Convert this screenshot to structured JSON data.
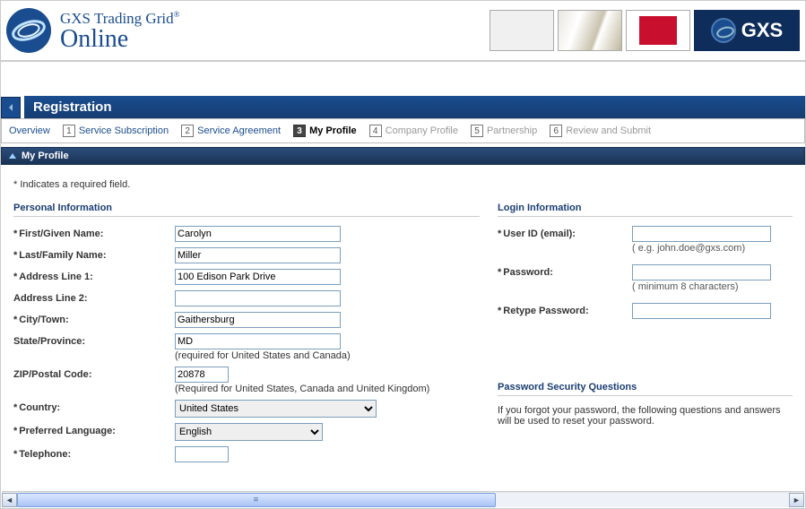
{
  "brand": {
    "line1": "GXS Trading Grid",
    "reg": "®",
    "line2": "Online",
    "badge": "GXS"
  },
  "section_title": "Registration",
  "steps": {
    "overview": "Overview",
    "s1_num": "1",
    "s1": "Service Subscription",
    "s2_num": "2",
    "s2": "Service Agreement",
    "s3_num": "3",
    "s3": "My Profile",
    "s4_num": "4",
    "s4": "Company Profile",
    "s5_num": "5",
    "s5": "Partnership",
    "s6_num": "6",
    "s6": "Review and Submit"
  },
  "panel_title": "My Profile",
  "required_note": "* Indicates a required field.",
  "personal": {
    "header": "Personal Information",
    "first_label": "First/Given Name:",
    "first_value": "Carolyn",
    "last_label": "Last/Family Name:",
    "last_value": "Miller",
    "addr1_label": "Address Line 1:",
    "addr1_value": "100 Edison Park Drive",
    "addr2_label": "Address Line 2:",
    "addr2_value": "",
    "city_label": "City/Town:",
    "city_value": "Gaithersburg",
    "state_label": "State/Province:",
    "state_value": "MD",
    "state_hint": "(required for United States and Canada)",
    "zip_label": "ZIP/Postal Code:",
    "zip_value": "20878",
    "zip_hint": "(Required for United States, Canada and United Kingdom)",
    "country_label": "Country:",
    "country_value": "United States",
    "lang_label": "Preferred Language:",
    "lang_value": "English",
    "phone_label": "Telephone:",
    "phone_value": ""
  },
  "login": {
    "header": "Login Information",
    "user_label": "User ID (email):",
    "user_value": "",
    "user_hint": "( e.g. john.doe@gxs.com)",
    "pw_label": "Password:",
    "pw_value": "",
    "pw_hint": "( minimum 8 characters)",
    "pw2_label": "Retype Password:",
    "pw2_value": ""
  },
  "secq": {
    "header": "Password Security Questions",
    "text": "If you forgot your password, the following questions and answers will be used to reset your password."
  }
}
